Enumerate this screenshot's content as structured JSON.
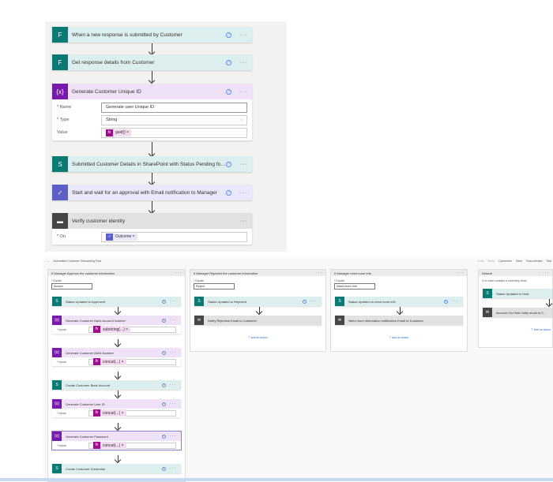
{
  "top_flow": {
    "trigger": "When a new response is submitted by Customer",
    "get_details": "Get response details from Customer",
    "init_var": {
      "title": "Generate Customer Unique ID",
      "name_label": "* Name",
      "name_value": "Generate user Unique ID",
      "type_label": "* Type",
      "type_value": "String",
      "value_label": "Value",
      "value_token": "guid()"
    },
    "sharepoint": "Submitted Customer Details in SharePoint with Status Pending for Verific...",
    "approval": "Start and wait for an approval with Email notification to Manager",
    "switch": {
      "title": "Verify customer identity",
      "on_label": "* On",
      "on_token": "Outcome"
    }
  },
  "toolbar": {
    "title": "Automated Customer Onboarding Flow",
    "undo": "Undo",
    "redo": "Redo",
    "comments": "Comments",
    "save": "Save",
    "flow_checker": "Flow checker",
    "test": "Test"
  },
  "cases": [
    {
      "title": "If Manager Approve the customer information",
      "equals_label": "* Equals",
      "equals": "Accept",
      "actions": [
        {
          "title": "Status Updated to Approved",
          "kind": "sp"
        },
        {
          "title": "Generate Customer Bank Account Number",
          "kind": "var",
          "input_label": "* Inputs",
          "token": "substring(...)"
        },
        {
          "title": "Generate Customer IBAN Number",
          "kind": "var",
          "input_label": "* Inputs",
          "token": "concat(...)"
        },
        {
          "title": "Create Customer Bank Account",
          "kind": "sp"
        },
        {
          "title": "Generate Customer User ID",
          "kind": "var",
          "input_label": "* Inputs",
          "token": "concat(...)"
        },
        {
          "title": "Generate Customer Password",
          "kind": "var",
          "input_label": "* Inputs",
          "token": "concat(...)"
        },
        {
          "title": "Create Customer Credential",
          "kind": "sp"
        }
      ]
    },
    {
      "title": "If Manager Rejected the customer information",
      "equals_label": "* Equals",
      "equals": "Reject",
      "actions": [
        {
          "title": "Status Updated to Rejected"
        },
        {
          "title": "Notify Rejection Email to Customer"
        }
      ],
      "add_action": "Add an action"
    },
    {
      "title": "If Manager need more info",
      "equals_label": "* Equals",
      "equals": "Need more info",
      "actions": [
        {
          "title": "Status Updated to need more info"
        },
        {
          "title": "Need more information notification Email to Customer"
        }
      ],
      "add_action": "Add an action"
    },
    {
      "title": "Default",
      "note": "If no case contains a matching value",
      "actions": [
        {
          "title": "Status Updated to Hold"
        },
        {
          "title": "Account On Hold notify email to Customer"
        }
      ],
      "add_action": "Add an action"
    }
  ]
}
